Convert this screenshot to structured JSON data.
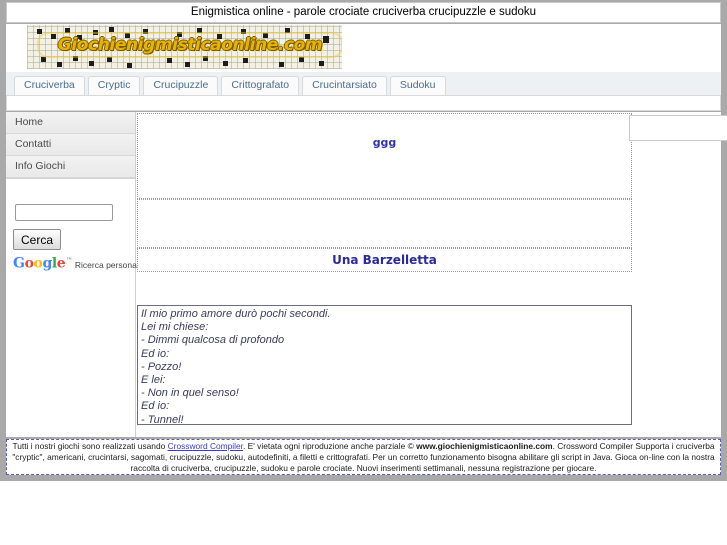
{
  "window": {
    "title": "Enigmistica online - parole crociate cruciverba crucipuzzle e sudoku"
  },
  "header": {
    "logo_text": "Giochienigmisticaonline.com",
    "logo_alt": "Giochienigmisticaonline.com crossword logo"
  },
  "nav": {
    "tabs": [
      {
        "label": "Cruciverba"
      },
      {
        "label": "Cryptic"
      },
      {
        "label": "Crucipuzzle"
      },
      {
        "label": "Crittografato"
      },
      {
        "label": "Crucintarsiato"
      },
      {
        "label": "Sudoku"
      }
    ]
  },
  "sidebar": {
    "items": [
      {
        "label": "Home"
      },
      {
        "label": "Contatti"
      },
      {
        "label": "Info Giochi"
      }
    ],
    "search": {
      "value": "",
      "placeholder": "",
      "button_label": "Cerca"
    },
    "google": {
      "logo_letters": [
        "G",
        "o",
        "o",
        "g",
        "l",
        "e"
      ],
      "trademark": "™",
      "caption": "Ricerca personalizzata"
    }
  },
  "main": {
    "top_text": "ggg",
    "joke_heading": "Una Barzelletta",
    "joke_body": "Il mio primo amore durò pochi secondi.\nLei mi chiese:\n- Dimmi qualcosa di profondo\nEd io:\n- Pozzo!\nE lei:\n- Non in quel senso!\nEd io:\n- Tunnel!"
  },
  "footer": {
    "part1": "Tutti i nostri giochi sono realizzati usando ",
    "link": "Crossword Compiler",
    "part2": ". E' vietata ogni riproduzione anche parziale © ",
    "domain": "www.giochienigmisticaonline.com",
    "part3": ". Crossword Compiler Supporta i cruciverba \"cryptic\", americani, crucintarsi, sagomati, crucipuzzle, sudoku, autodefiniti, a filetti e crittografati. Per un corretto funzionamento bisogna abilitare gli script in Java. Gioca on-line con la nostra raccolta di cruciverba, crucipuzzle, sudoku e parole crociate. Nuovi inserimenti settimanali, nessuna registrazione per giocare."
  },
  "colors": {
    "accent_blue": "#2a2a9e",
    "link_blue": "#3a3ad0",
    "tab_text": "#4a6c8e",
    "logo_gold": "#e8b200",
    "chrome_gray": "#a9a9a9"
  }
}
